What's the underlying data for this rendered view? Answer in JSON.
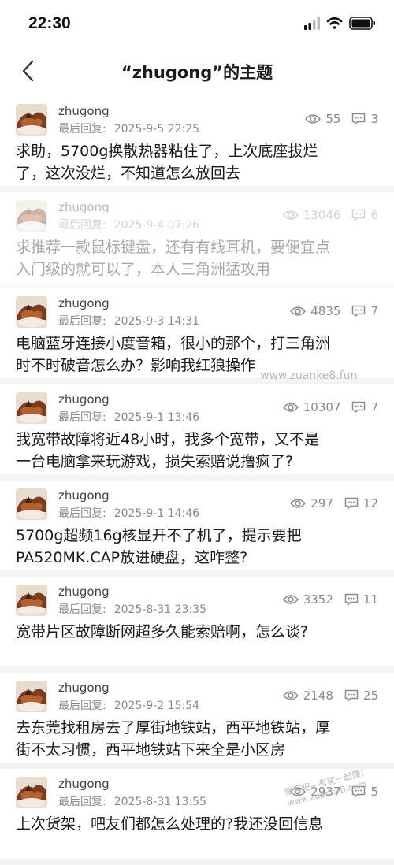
{
  "status_bar": {
    "time": "22:30"
  },
  "nav": {
    "title": "“zhugong”的主题"
  },
  "threads": [
    {
      "author": "zhugong",
      "last_reply_label": "最后回复:",
      "last_reply_time": "2025-9-5 22:25",
      "views": "55",
      "replies": "3",
      "title": "求助，5700g换散热器粘住了，上次底座拔烂\n了，这次没烂，不知道怎么放回去",
      "faded": false
    },
    {
      "author": "zhugong",
      "last_reply_label": "最后回复:",
      "last_reply_time": "2025-9-4 07:26",
      "views": "13046",
      "replies": "6",
      "title": "求推荐一款鼠标键盘，还有有线耳机，要便宜点\n入门级的就可以了，本人三角洲猛攻用",
      "faded": true
    },
    {
      "author": "zhugong",
      "last_reply_label": "最后回复:",
      "last_reply_time": "2025-9-3 14:31",
      "views": "4835",
      "replies": "7",
      "title": "电脑蓝牙连接小度音箱，很小的那个，打三角洲\n时不时破音怎么办？影响我红狼操作",
      "faded": false
    },
    {
      "author": "zhugong",
      "last_reply_label": "最后回复:",
      "last_reply_time": "2025-9-1 13:46",
      "views": "10307",
      "replies": "7",
      "title": "我宽带故障将近48小时，我多个宽带，又不是\n一台电脑拿来玩游戏，损失索赔说撸疯了?",
      "faded": false
    },
    {
      "author": "zhugong",
      "last_reply_label": "最后回复:",
      "last_reply_time": "2025-9-1 14:46",
      "views": "297",
      "replies": "12",
      "title": "5700g超频16g核显开不了机了，提示要把\nPA520MK.CAP放进硬盘，这咋整?",
      "faded": false
    },
    {
      "author": "zhugong",
      "last_reply_label": "最后回复:",
      "last_reply_time": "2025-8-31 23:35",
      "views": "3352",
      "replies": "11",
      "title": "宽带片区故障断网超多久能索赔啊，怎么谈?",
      "faded": false
    },
    {
      "author": "zhugong",
      "last_reply_label": "最后回复:",
      "last_reply_time": "2025-9-2 15:54",
      "views": "2148",
      "replies": "25",
      "title": "去东莞找租房去了厚街地铁站，西平地铁站，厚\n街不太习惯，西平地铁站下来全是小区房",
      "faded": false
    },
    {
      "author": "zhugong",
      "last_reply_label": "最后回复:",
      "last_reply_time": "2025-8-31 13:55",
      "views": "2937",
      "replies": "5",
      "title": "上次货架，吧友们都怎么处理的?我还没回信息",
      "faded": false
    }
  ],
  "watermarks": {
    "mid": "www.zuanke8.fun",
    "corner": "赚客吧—有奖一起赚! www.zuanke8.com"
  },
  "colors": {
    "meta_gray": "#8a8a8a",
    "title_text": "#1a1a1a",
    "divider": "#f3f3f3"
  }
}
